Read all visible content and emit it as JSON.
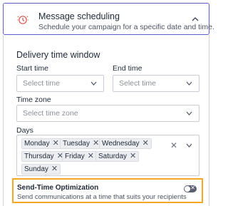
{
  "header": {
    "title": "Message scheduling",
    "subtitle": "Schedule your campaign for a specific date and time.",
    "icon": "clock-icon",
    "collapse_icon": "chevron-up-icon",
    "accent": "#5b5fc7"
  },
  "delivery": {
    "section_title": "Delivery time window",
    "start_label": "Start time",
    "start_placeholder": "Select time",
    "end_label": "End time",
    "end_placeholder": "Select time",
    "timezone_label": "Time zone",
    "timezone_placeholder": "Select time zone",
    "days_label": "Days",
    "days": [
      "Monday",
      "Tuesday",
      "Wednesday",
      "Thursday",
      "Friday",
      "Saturday",
      "Sunday"
    ]
  },
  "sto": {
    "title": "Send-Time Optimization",
    "description": "Send communications at a time that suits your recipients",
    "enabled": false,
    "highlight": "#f5a623"
  }
}
